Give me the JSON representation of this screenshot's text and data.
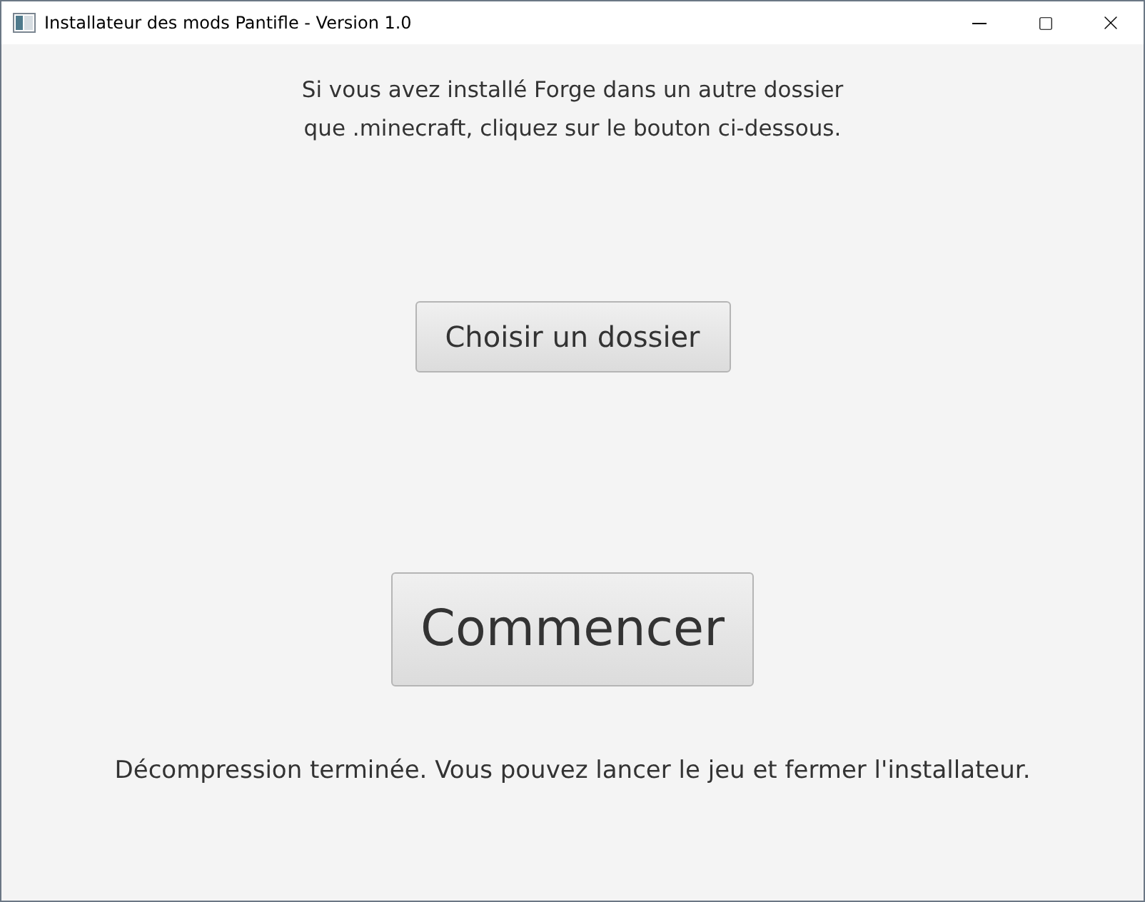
{
  "window": {
    "title": "Installateur des mods Pantifle - Version 1.0"
  },
  "intro": [
    "Si vous avez installé Forge dans un autre dossier",
    "que .minecraft, cliquez sur le bouton ci-dessous."
  ],
  "choose_button": "Choisir un dossier",
  "start_button": "Commencer",
  "status": "Décompression terminée. Vous pouvez lancer le jeu et fermer l'installateur."
}
